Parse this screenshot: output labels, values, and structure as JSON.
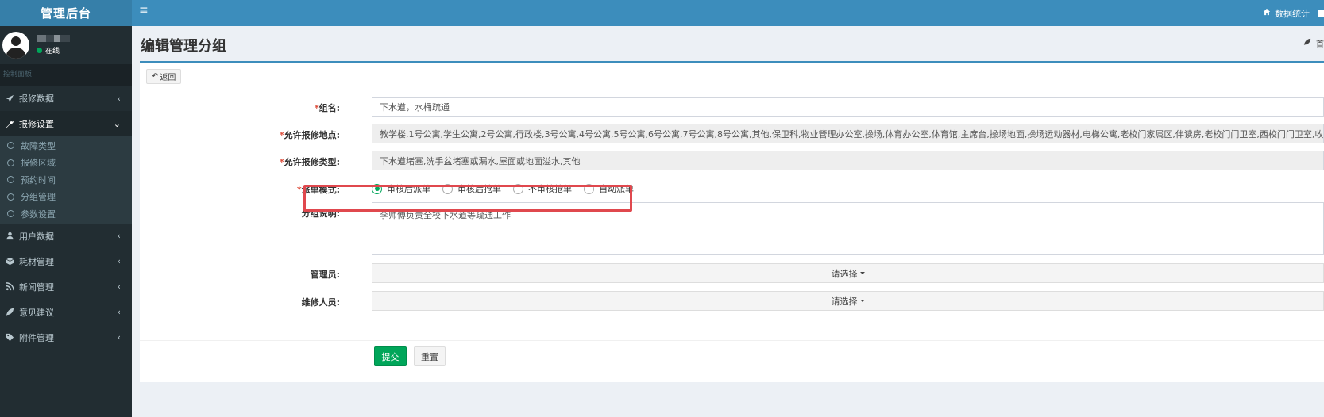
{
  "app": {
    "title": "管理后台"
  },
  "user": {
    "status": "在线"
  },
  "sidebar": {
    "header": "控制面板",
    "items": [
      {
        "label": "报修数据",
        "icon": "paper-plane-icon"
      },
      {
        "label": "报修设置",
        "icon": "wrench-icon",
        "expanded": true
      },
      {
        "label": "用户数据",
        "icon": "user-icon"
      },
      {
        "label": "耗材管理",
        "icon": "cube-icon"
      },
      {
        "label": "新闻管理",
        "icon": "rss-icon"
      },
      {
        "label": "意见建议",
        "icon": "leaf-icon"
      },
      {
        "label": "附件管理",
        "icon": "tags-icon"
      }
    ],
    "sub_items": [
      "故障类型",
      "报修区域",
      "预约时间",
      "分组管理",
      "参数设置"
    ]
  },
  "navbar": {
    "dashboard": "数据统计"
  },
  "page": {
    "title": "编辑管理分组",
    "breadcrumb": "首"
  },
  "form": {
    "back": "返回",
    "name_label": "组名:",
    "name_value": "下水道，水桶疏通",
    "locations_label": "允许报修地点:",
    "locations_value": "教学楼,1号公寓,学生公寓,2号公寓,行政楼,3号公寓,4号公寓,5号公寓,6号公寓,7号公寓,8号公寓,其他,保卫科,物业管理办公室,操场,体育办公室,体育馆,主席台,操场地面,操场运动器材,电梯公寓,老校门家属区,伴读房,老校门门卫室,西校门门卫室,收发室（老校门旁",
    "types_label": "允许报修类型:",
    "types_value": "下水道堵塞,洗手盆堵塞或漏水,屋面或地面溢水,其他",
    "dispatch_label": "派单模式:",
    "dispatch_options": [
      "审核后派单",
      "审核后抢单",
      "不审核抢单",
      "自动派单"
    ],
    "dispatch_selected": "审核后派单",
    "desc_label": "分组说明:",
    "desc_value": "李师傅负责全校下水道等疏通工作",
    "admin_label": "管理员:",
    "admin_placeholder": "请选择",
    "repair_label": "维修人员:",
    "repair_placeholder": "请选择",
    "submit": "提交",
    "reset": "重置"
  },
  "colors": {
    "navbar": "#3c8dbc",
    "logo": "#367fa9",
    "sidebar": "#222d32",
    "success": "#00a65a",
    "highlight": "#e0484e"
  }
}
